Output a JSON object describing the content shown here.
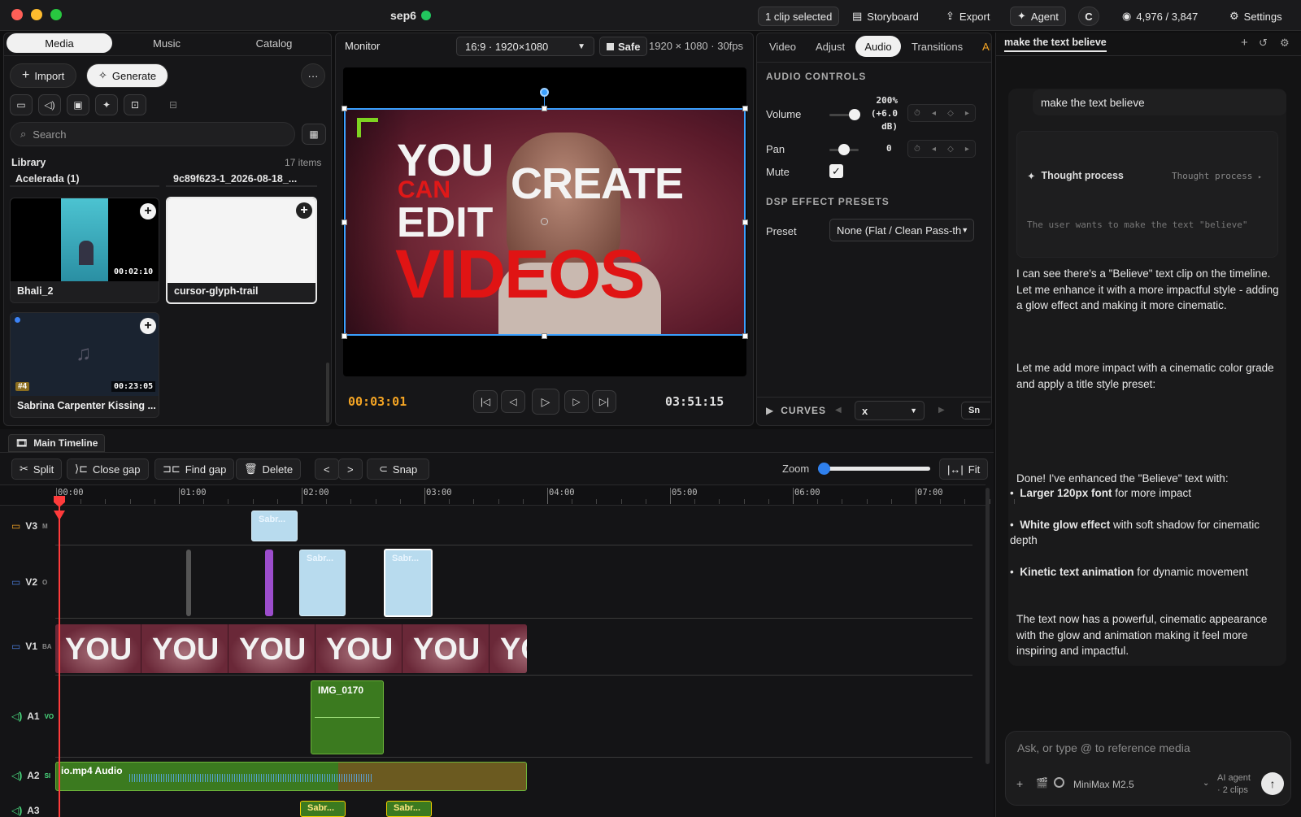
{
  "titlebar": {
    "project": "sep6",
    "clip_selected": "1 clip selected",
    "storyboard": "Storyboard",
    "export": "Export",
    "agent": "Agent",
    "user_initial": "C",
    "credits": "4,976 / 3,847",
    "settings": "Settings"
  },
  "media_panel": {
    "tabs": [
      "Media",
      "Music",
      "Catalog"
    ],
    "import": "Import",
    "generate": "Generate",
    "more": "···",
    "search_placeholder": "Search",
    "library_title": "Library",
    "library_count": "17 items",
    "top_items": [
      "Acelerada (1)",
      "9c89f623-1_2026-08-18_..."
    ],
    "cards": [
      {
        "name": "Bhali_2",
        "duration": "00:02:10"
      },
      {
        "name": "cursor-glyph-trail",
        "duration": ""
      },
      {
        "name": "Sabrina Carpenter Kissing ...",
        "duration": "00:23:05",
        "badge": "#4"
      }
    ]
  },
  "monitor": {
    "title": "Monitor",
    "aspect": "16:9 · 1920×1080",
    "safe": "Safe",
    "resolution": "1920 × 1080 · 30fps",
    "overlay": {
      "you": "YOU",
      "can": "CAN",
      "create": "CREATE",
      "edit": "EDIT",
      "videos": "VIDEOS"
    },
    "current_time": "00:03:01",
    "total_time": "03:51:15"
  },
  "inspector": {
    "tabs": [
      "Video",
      "Adjust",
      "Audio",
      "Transitions",
      "AI"
    ],
    "audio_controls_title": "AUDIO CONTROLS",
    "volume_label": "Volume",
    "volume_value": "200%",
    "volume_db": "(+6.0",
    "volume_db_unit": "dB)",
    "volume_level": 0.85,
    "pan_label": "Pan",
    "pan_value": "0",
    "pan_level": 0.5,
    "mute_label": "Mute",
    "dsp_title": "DSP EFFECT PRESETS",
    "preset_label": "Preset",
    "preset_value": "None (Flat / Clean Pass-th",
    "curves_label": "CURVES",
    "curves_select": "x",
    "curves_right": "Sn"
  },
  "timeline": {
    "tab": "Main Timeline",
    "split": "Split",
    "close_gap": "Close gap",
    "find_gap": "Find gap",
    "delete": "Delete",
    "prev": "<",
    "next": ">",
    "snap": "Snap",
    "zoom": "Zoom",
    "fit": "Fit",
    "ruler": [
      "00:00",
      "01:00",
      "02:00",
      "03:00",
      "04:00",
      "05:00",
      "06:00",
      "07:00"
    ],
    "tracks": [
      {
        "name": "V3",
        "tag": "M"
      },
      {
        "name": "V2",
        "tag": "O"
      },
      {
        "name": "V1",
        "tag": "BA"
      },
      {
        "name": "A1",
        "tag": "VO"
      },
      {
        "name": "A2",
        "tag": "SI"
      },
      {
        "name": "A3",
        "tag": ""
      }
    ],
    "clip_sabr": "Sabr...",
    "clip_io": "io",
    "clip_you": "YOU",
    "clip_img": "IMG_0170",
    "clip_audio": "io.mp4 Audio"
  },
  "chat": {
    "tab_title": "make the text believe",
    "user_message": "make the text believe",
    "thought_label": "Thought process",
    "thought_toggle": "Thought process",
    "thought_preview": "The user wants to make the text \"believe\"",
    "msg1": "I can see there's a \"Believe\" text clip on the timeline. Let me enhance it with a more impactful style - adding a glow effect and making it more cinematic.",
    "msg2": "Let me add more impact with a cinematic color grade and apply a title style preset:",
    "msg3": "Done! I've enhanced the \"Believe\" text with:",
    "bullets": [
      {
        "bold": "Larger 120px font",
        "rest": " for more impact"
      },
      {
        "bold": "White glow effect",
        "rest": " with soft shadow for cinematic depth"
      },
      {
        "bold": "Kinetic text animation",
        "rest": " for dynamic movement"
      }
    ],
    "msg4": "The text now has a powerful, cinematic appearance with the glow and animation making it feel more inspiring and impactful.",
    "input_placeholder": "Ask, or type @ to reference media",
    "model": "MiniMax M2.5",
    "agent_label": "AI agent",
    "clips_label": "· 2 clips"
  }
}
